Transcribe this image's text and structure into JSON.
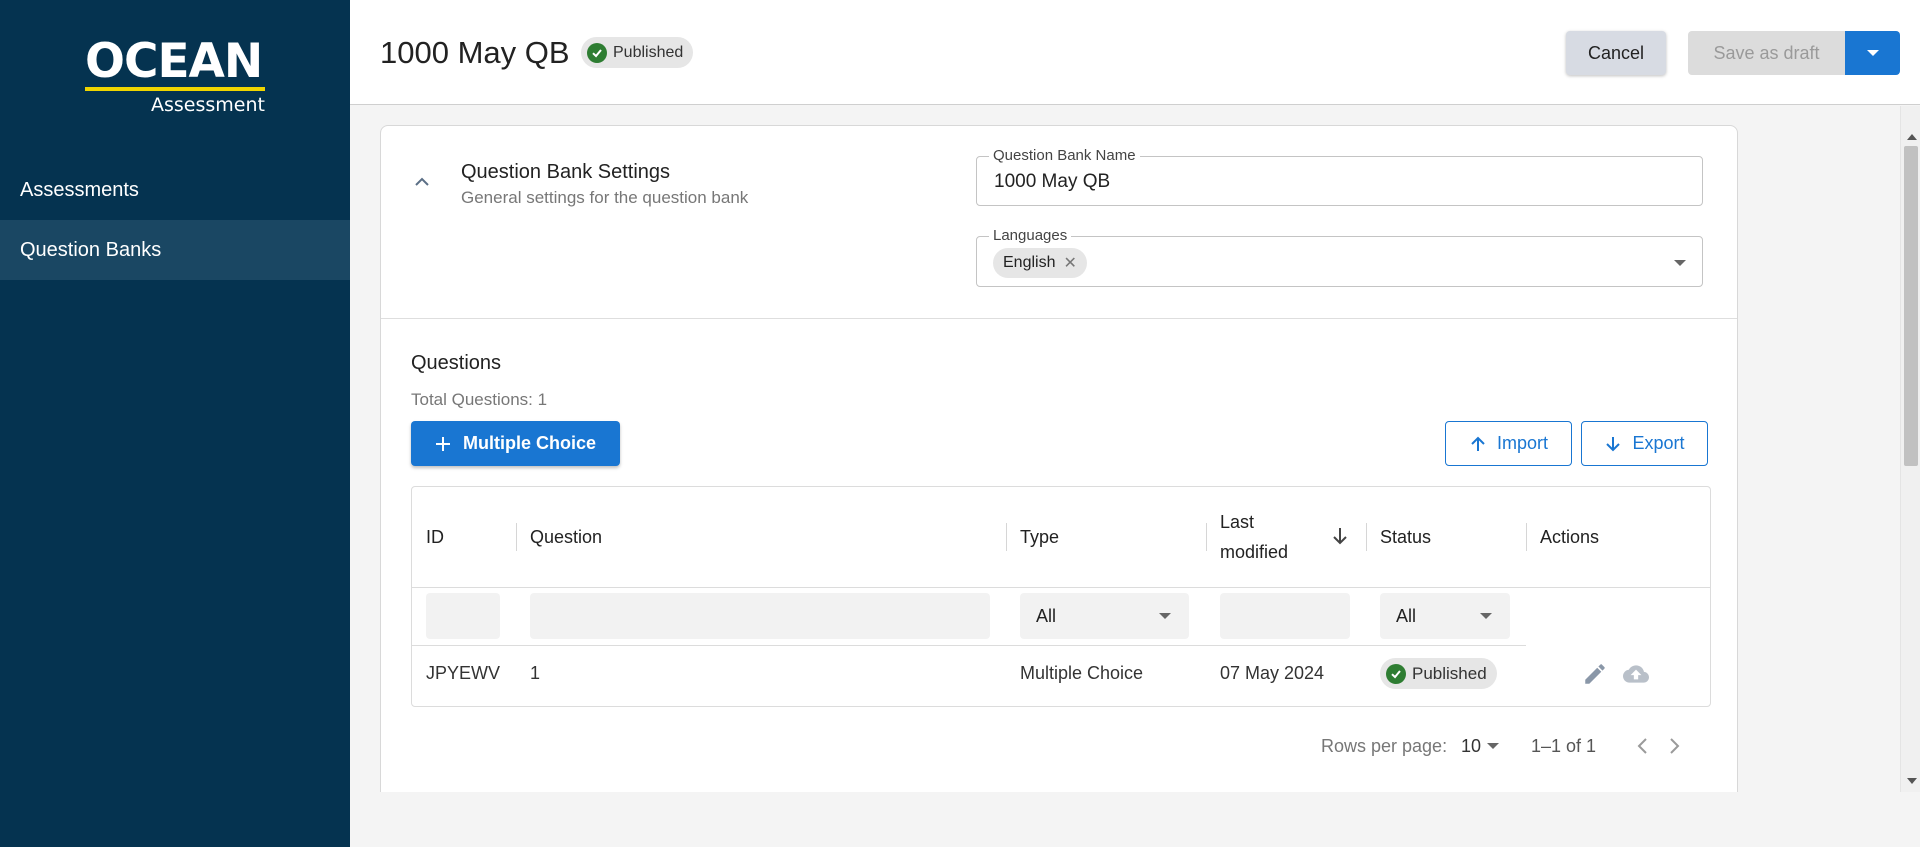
{
  "brand": {
    "name": "OCEAN",
    "subtitle": "Assessment",
    "accent_color": "#f0d500",
    "sidebar_color": "#053350"
  },
  "sidebar": {
    "items": [
      {
        "label": "Assessments",
        "active": false
      },
      {
        "label": "Question Banks",
        "active": true
      }
    ]
  },
  "header": {
    "title": "1000 May QB",
    "status": "Published",
    "cancel_label": "Cancel",
    "save_label": "Save as draft",
    "primary_color": "#1976d2"
  },
  "settings": {
    "title": "Question Bank Settings",
    "subtitle": "General settings for the question bank",
    "name_label": "Question Bank Name",
    "name_value": "1000 May QB",
    "languages_label": "Languages",
    "languages": [
      "English"
    ]
  },
  "questions": {
    "title": "Questions",
    "total": "Total Questions: 1",
    "add_label": "Multiple Choice",
    "import_label": "Import",
    "export_label": "Export"
  },
  "table": {
    "columns": {
      "id": "ID",
      "question": "Question",
      "type": "Type",
      "last_modified_1": "Last",
      "last_modified_2": "modified",
      "status": "Status",
      "actions": "Actions"
    },
    "filters": {
      "type": "All",
      "status": "All"
    },
    "rows": [
      {
        "id": "JPYEWV",
        "question": "1",
        "type": "Multiple Choice",
        "last_modified": "07 May 2024",
        "status": "Published"
      }
    ]
  },
  "pagination": {
    "rows_label": "Rows per page:",
    "rows_value": "10",
    "range": "1–1 of 1"
  }
}
